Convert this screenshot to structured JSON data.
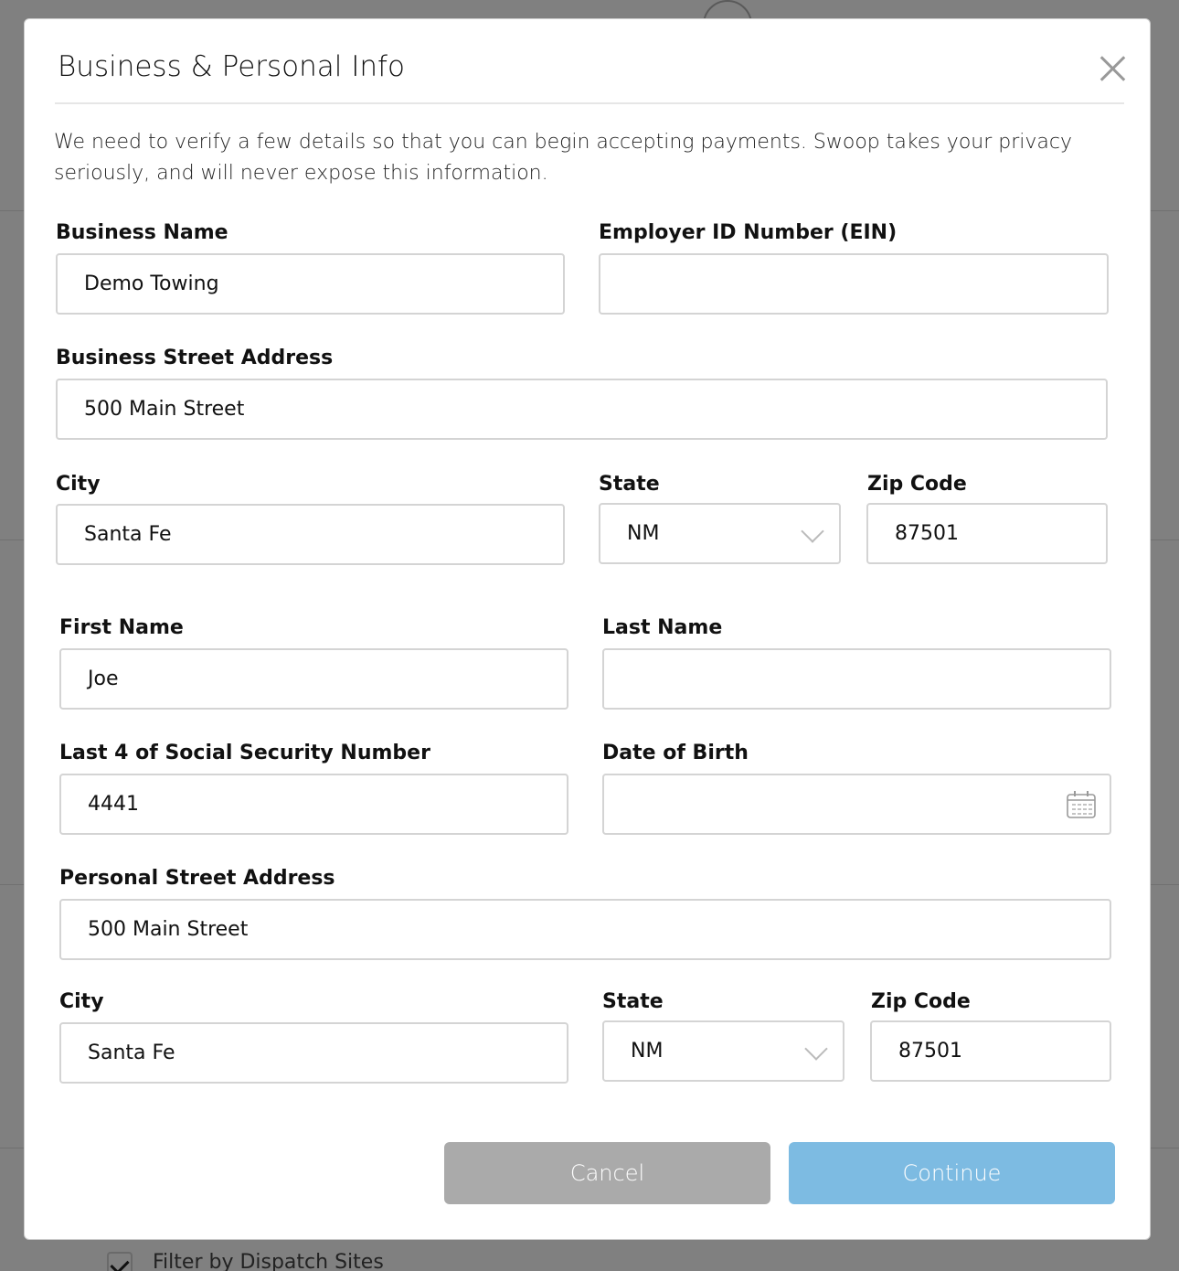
{
  "background": {
    "checkbox_label": "Filter by Dispatch Sites",
    "checkbox_checked": true
  },
  "modal": {
    "title": "Business & Personal Info",
    "intro": "We need to verify a few details so that you can begin accepting payments. Swoop takes your privacy seriously, and will never expose this information.",
    "business": {
      "name": {
        "label": "Business Name",
        "value": "Demo Towing"
      },
      "ein": {
        "label": "Employer ID Number (EIN)",
        "value": ""
      },
      "street": {
        "label": "Business Street Address",
        "value": "500 Main Street"
      },
      "city": {
        "label": "City",
        "value": "Santa Fe"
      },
      "state": {
        "label": "State",
        "value": "NM"
      },
      "zip": {
        "label": "Zip Code",
        "value": "87501"
      }
    },
    "personal": {
      "first_name": {
        "label": "First Name",
        "value": "Joe"
      },
      "last_name": {
        "label": "Last Name",
        "value": ""
      },
      "ssn4": {
        "label": "Last 4 of Social Security Number",
        "value": "4441"
      },
      "dob": {
        "label": "Date of Birth",
        "value": ""
      },
      "street": {
        "label": "Personal Street Address",
        "value": "500 Main Street"
      },
      "city": {
        "label": "City",
        "value": "Santa Fe"
      },
      "state": {
        "label": "State",
        "value": "NM"
      },
      "zip": {
        "label": "Zip Code",
        "value": "87501"
      }
    },
    "buttons": {
      "cancel": "Cancel",
      "continue": "Continue"
    },
    "colors": {
      "continue": "#7dbbe2",
      "cancel": "#aaaaaa"
    }
  }
}
